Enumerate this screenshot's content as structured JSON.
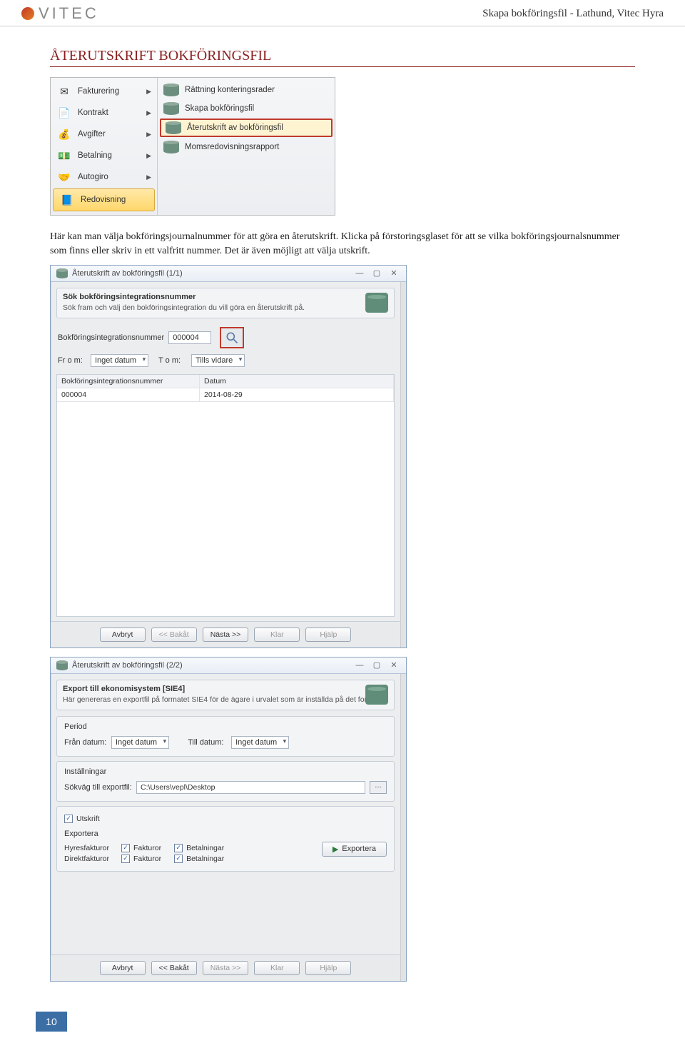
{
  "header": {
    "logo_text": "VITEC",
    "doc_title": "Skapa bokföringsfil - Lathund, Vitec Hyra"
  },
  "section_heading": "ÅTERUTSKRIFT BOKFÖRINGSFIL",
  "menu": {
    "left": [
      {
        "label": "Fakturering",
        "icon": "✉"
      },
      {
        "label": "Kontrakt",
        "icon": "📄"
      },
      {
        "label": "Avgifter",
        "icon": "💰"
      },
      {
        "label": "Betalning",
        "icon": "💵"
      },
      {
        "label": "Autogiro",
        "icon": "🤝"
      },
      {
        "label": "Redovisning",
        "icon": "📘"
      }
    ],
    "right": [
      {
        "label": "Rättning konteringsrader"
      },
      {
        "label": "Skapa bokföringsfil"
      },
      {
        "label": "Återutskrift av bokföringsfil"
      },
      {
        "label": "Momsredovisningsrapport"
      }
    ]
  },
  "body_para": "Här kan man välja bokföringsjournalnummer för att göra en återutskrift. Klicka på förstoringsglaset för att se vilka bokföringsjournalsnummer som finns eller skriv in ett valfritt nummer. Det är även möjligt att välja utskrift.",
  "dialog1": {
    "title": "Återutskrift av bokföringsfil (1/1)",
    "section_title": "Sök bokföringsintegrationsnummer",
    "section_sub": "Sök fram och välj den bokföringsintegration du vill göra en återutskrift på.",
    "field_label": "Bokföringsintegrationsnummer",
    "field_value": "000004",
    "from_label": "Fr o m:",
    "from_value": "Inget datum",
    "to_label": "T o m:",
    "to_value": "Tills vidare",
    "col1": "Bokföringsintegrationsnummer",
    "col2": "Datum",
    "row1_c1": "000004",
    "row1_c2": "2014-08-29",
    "buttons": {
      "cancel": "Avbryt",
      "back": "<< Bakåt",
      "next": "Nästa >>",
      "finish": "Klar",
      "help": "Hjälp"
    }
  },
  "dialog2": {
    "title": "Återutskrift av bokföringsfil (2/2)",
    "section_title": "Export till ekonomisystem [SIE4]",
    "section_sub": "Här genereras en exportfil på formatet SIE4 för de ägare i urvalet som är inställda på det formatet",
    "period_title": "Period",
    "from_label": "Från datum:",
    "from_value": "Inget datum",
    "to_label": "Till datum:",
    "to_value": "Inget datum",
    "settings_title": "Inställningar",
    "path_label": "Sökväg till exportfil:",
    "path_value": "C:\\Users\\vepl\\Desktop",
    "print_label": "Utskrift",
    "export_title": "Exportera",
    "row1_label": "Hyresfakturor",
    "row2_label": "Direktfakturor",
    "chk_fakturor": "Fakturor",
    "chk_betalningar": "Betalningar",
    "export_btn": "Exportera",
    "buttons": {
      "cancel": "Avbryt",
      "back": "<< Bakåt",
      "next": "Nästa >>",
      "finish": "Klar",
      "help": "Hjälp"
    }
  },
  "page_number": "10"
}
